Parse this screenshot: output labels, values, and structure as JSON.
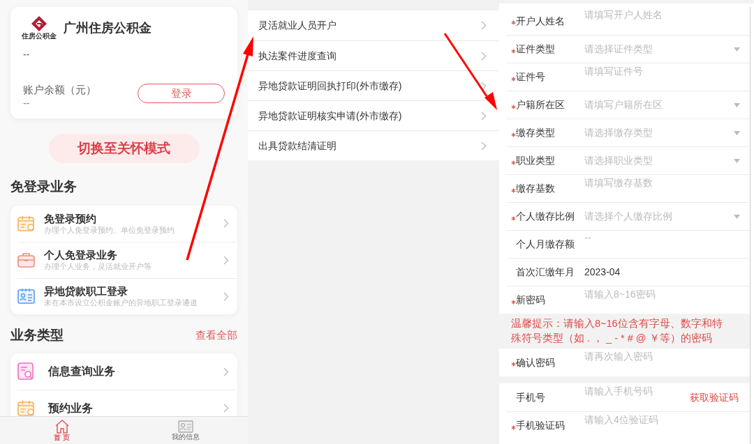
{
  "home": {
    "logo_text": "住房公积金",
    "title": "广州住房公积金",
    "account": "--",
    "balance_label": "账户余额（元）",
    "balance": "--",
    "login_button": "登录",
    "care_mode_button": "切换至关怀模式",
    "no_login_section": {
      "title": "免登录业务",
      "items": [
        {
          "kind": "calendar",
          "title": "免登录预约",
          "subtitle": "办理个人免登录预约、单位免登录预约"
        },
        {
          "kind": "briefcase",
          "title": "个人免登录业务",
          "subtitle": "办理个人业务，灵活就业开户等"
        },
        {
          "kind": "idcard",
          "title": "异地贷款职工登录",
          "subtitle": "未在本市设立公积金账户的异地职工登录通道"
        }
      ]
    },
    "business_section": {
      "title": "业务类型",
      "link": "查看全部",
      "items": [
        {
          "kind": "search-doc",
          "title": "信息查询业务"
        },
        {
          "kind": "calendar",
          "title": "预约业务"
        }
      ]
    },
    "tab_bar": [
      {
        "kind": "home",
        "label": "首 页",
        "selected": true
      },
      {
        "kind": "profile",
        "label": "我的信息",
        "selected": false
      }
    ]
  },
  "service_menu": {
    "items": [
      "灵活就业人员开户",
      "执法案件进度查询",
      "异地贷款证明回执打印(外市缴存)",
      "异地贷款证明核实申请(外市缴存)",
      "出具贷款结清证明"
    ]
  },
  "form": {
    "fields": [
      {
        "kind": "input",
        "label": "开户人姓名",
        "required": true,
        "placeholder": "请填写开户人姓名"
      },
      {
        "kind": "select",
        "label": "证件类型",
        "required": true,
        "placeholder": "请选择证件类型"
      },
      {
        "kind": "input",
        "label": "证件号",
        "required": true,
        "placeholder": "请填写证件号"
      },
      {
        "kind": "select",
        "label": "户籍所在区",
        "required": true,
        "placeholder": "请填写户籍所在区"
      },
      {
        "kind": "select",
        "label": "缴存类型",
        "required": true,
        "placeholder": "请选择缴存类型"
      },
      {
        "kind": "select",
        "label": "职业类型",
        "required": true,
        "placeholder": "请选择职业类型"
      },
      {
        "kind": "input",
        "label": "缴存基数",
        "required": true,
        "placeholder": "请填写缴存基数"
      },
      {
        "kind": "select",
        "label": "个人缴存比例",
        "required": true,
        "placeholder": "请选择个人缴存比例"
      },
      {
        "kind": "readonly",
        "label": "个人月缴存额",
        "required": false,
        "value": "--",
        "muted": true
      },
      {
        "kind": "readonly",
        "label": "首次汇缴年月",
        "required": false,
        "value": "2023-04",
        "muted": false
      },
      {
        "kind": "input",
        "label": "新密码",
        "required": true,
        "placeholder": "请输入8~16密码"
      },
      {
        "kind": "tip",
        "text": "温馨提示：请输入8~16位含有字母、数字和特殊符号类型（如 . ， _ - * # @ ￥等）的密码"
      },
      {
        "kind": "input",
        "label": "确认密码",
        "required": true,
        "placeholder": "请再次输入密码"
      },
      {
        "kind": "gap"
      },
      {
        "kind": "input",
        "label": "手机号",
        "required": false,
        "placeholder": "请输入手机号码",
        "action": "获取验证码"
      },
      {
        "kind": "input",
        "label": "手机验证码",
        "required": true,
        "placeholder": "请输入4位验证码"
      }
    ]
  }
}
